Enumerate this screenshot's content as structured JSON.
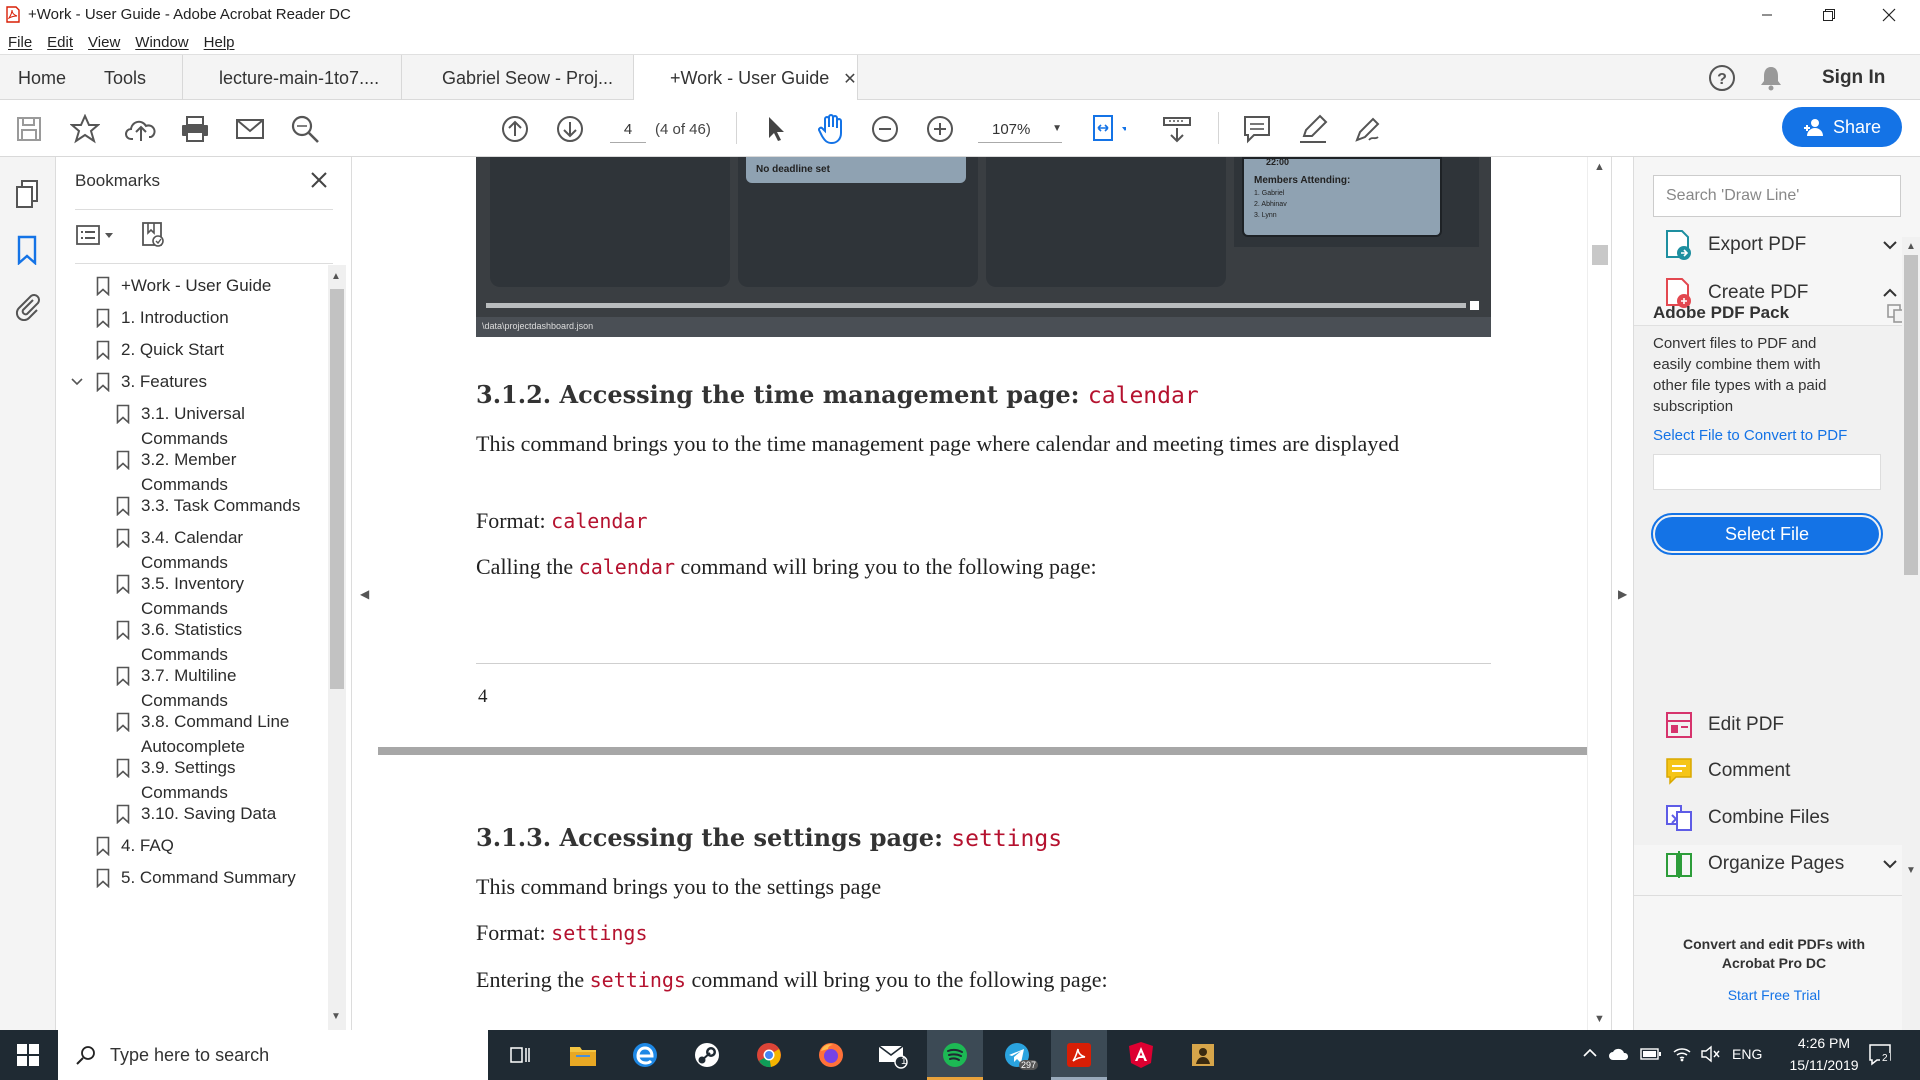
{
  "window": {
    "title": "+Work - User Guide - Adobe Acrobat Reader DC"
  },
  "menu": [
    "File",
    "Edit",
    "View",
    "Window",
    "Help"
  ],
  "tabs": {
    "home": "Home",
    "tools": "Tools",
    "documents": [
      "lecture-main-1to7....",
      "Gabriel Seow - Proj...",
      "+Work - User Guide"
    ],
    "sign_in": "Sign In"
  },
  "toolbar": {
    "page_number": "4",
    "page_count": "(4 of 46)",
    "zoom": "107%",
    "share_label": "Share"
  },
  "bookmarks": {
    "title": "Bookmarks",
    "items": [
      {
        "label": "+Work - User Guide"
      },
      {
        "label": "1. Introduction"
      },
      {
        "label": "2. Quick Start"
      },
      {
        "label": "3. Features"
      },
      {
        "label": "3.1. Universal Commands"
      },
      {
        "label": "3.2. Member Commands"
      },
      {
        "label": "3.3. Task Commands"
      },
      {
        "label": "3.4. Calendar Commands"
      },
      {
        "label": "3.5. Inventory Commands"
      },
      {
        "label": "3.6. Statistics Commands"
      },
      {
        "label": "3.7. Multiline Commands"
      },
      {
        "label": "3.8. Command Line Autocomplete"
      },
      {
        "label": "3.9. Settings Commands"
      },
      {
        "label": "3.10. Saving Data"
      },
      {
        "label": "4. FAQ"
      },
      {
        "label": "5. Command Summary"
      }
    ]
  },
  "document": {
    "screenshot": {
      "card_left": "No deadline set",
      "card_right_top": "22:00",
      "members_heading": "Members Attending:",
      "members": [
        "1. Gabriel",
        "2. Abhinav",
        "3. Lynn"
      ],
      "path": "\\data\\projectdashboard.json"
    },
    "section_312": {
      "heading": "3.1.2. Accessing the time management page:",
      "heading_code": "calendar",
      "para1": "This command brings you to the time management page where calendar and meeting times are displayed",
      "format_label": "Format:",
      "format_code": "calendar",
      "call_pre": "Calling the",
      "call_code": "calendar",
      "call_post": "command will bring you to the following page:"
    },
    "page_footer_number": "4",
    "section_313": {
      "heading": "3.1.3. Accessing the settings page:",
      "heading_code": "settings",
      "para1": "This command brings you to the settings page",
      "format_label": "Format:",
      "format_code": "settings",
      "enter_pre": "Entering the",
      "enter_code": "settings",
      "enter_post": "command will bring you to the following page:"
    }
  },
  "right_panel": {
    "search_placeholder": "Search 'Draw Line'",
    "export_pdf": "Export PDF",
    "create_pdf": "Create PDF",
    "pack_title": "Adobe PDF Pack",
    "pack_desc": "Convert files to PDF and easily combine them with other file types with a paid subscription",
    "select_convert_label": "Select File to Convert to PDF",
    "select_file_button": "Select File",
    "edit_pdf": "Edit PDF",
    "comment": "Comment",
    "combine_files": "Combine Files",
    "organize_pages": "Organize Pages",
    "promo": "Convert and edit PDFs with Acrobat Pro DC",
    "trial_link": "Start Free Trial"
  },
  "taskbar": {
    "search_placeholder": "Type here to search",
    "mail_badge": "1",
    "telegram_badge": "297",
    "language": "ENG",
    "time": "4:26 PM",
    "date": "15/11/2019",
    "notification_count": "2"
  },
  "colors": {
    "accent_blue": "#1473e6",
    "code_red": "#b5122f",
    "taskbar": "#1f2a33"
  }
}
